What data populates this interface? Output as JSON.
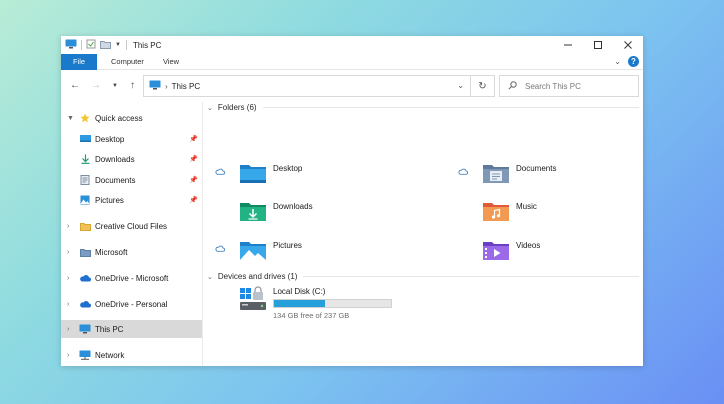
{
  "window": {
    "title": "This PC",
    "controls": [
      "minimize-icon",
      "maximize-icon",
      "close-icon"
    ]
  },
  "ribbon": {
    "tabs": [
      {
        "label": "File",
        "active": true
      },
      {
        "label": "Computer"
      },
      {
        "label": "View"
      }
    ],
    "accent": "#1979ca"
  },
  "address": {
    "path": "This PC",
    "search_placeholder": "Search This PC"
  },
  "sidebar": {
    "items": [
      {
        "label": "Quick access",
        "icon": "star-icon",
        "expanded": true
      },
      {
        "label": "Desktop",
        "icon": "desktop-icon",
        "pinned": true
      },
      {
        "label": "Downloads",
        "icon": "download-icon",
        "pinned": true
      },
      {
        "label": "Documents",
        "icon": "documents-icon",
        "pinned": true
      },
      {
        "label": "Pictures",
        "icon": "pictures-icon",
        "pinned": true
      },
      {
        "label": "Creative Cloud Files",
        "icon": "creative-cloud-icon"
      },
      {
        "label": "Microsoft",
        "icon": "folder-icon"
      },
      {
        "label": "OneDrive - Microsoft",
        "icon": "cloud-icon"
      },
      {
        "label": "OneDrive - Personal",
        "icon": "cloud-icon"
      },
      {
        "label": "This PC",
        "icon": "computer-icon",
        "selected": true
      },
      {
        "label": "Network",
        "icon": "network-icon"
      }
    ]
  },
  "content": {
    "folders_header": "Folders (6)",
    "folders": [
      {
        "label": "Desktop",
        "icon": "desktop-folder-icon",
        "cloud": true
      },
      {
        "label": "Documents",
        "icon": "documents-folder-icon",
        "cloud": true
      },
      {
        "label": "Downloads",
        "icon": "downloads-folder-icon",
        "cloud": false
      },
      {
        "label": "Music",
        "icon": "music-folder-icon",
        "cloud": false
      },
      {
        "label": "Pictures",
        "icon": "pictures-folder-icon",
        "cloud": true
      },
      {
        "label": "Videos",
        "icon": "videos-folder-icon",
        "cloud": false
      }
    ],
    "drives_header": "Devices and drives (1)",
    "drive": {
      "name": "Local Disk (C:)",
      "free_text": "134 GB free of 237 GB",
      "used_fraction": 0.435,
      "bar_color": "#26a0da"
    }
  }
}
